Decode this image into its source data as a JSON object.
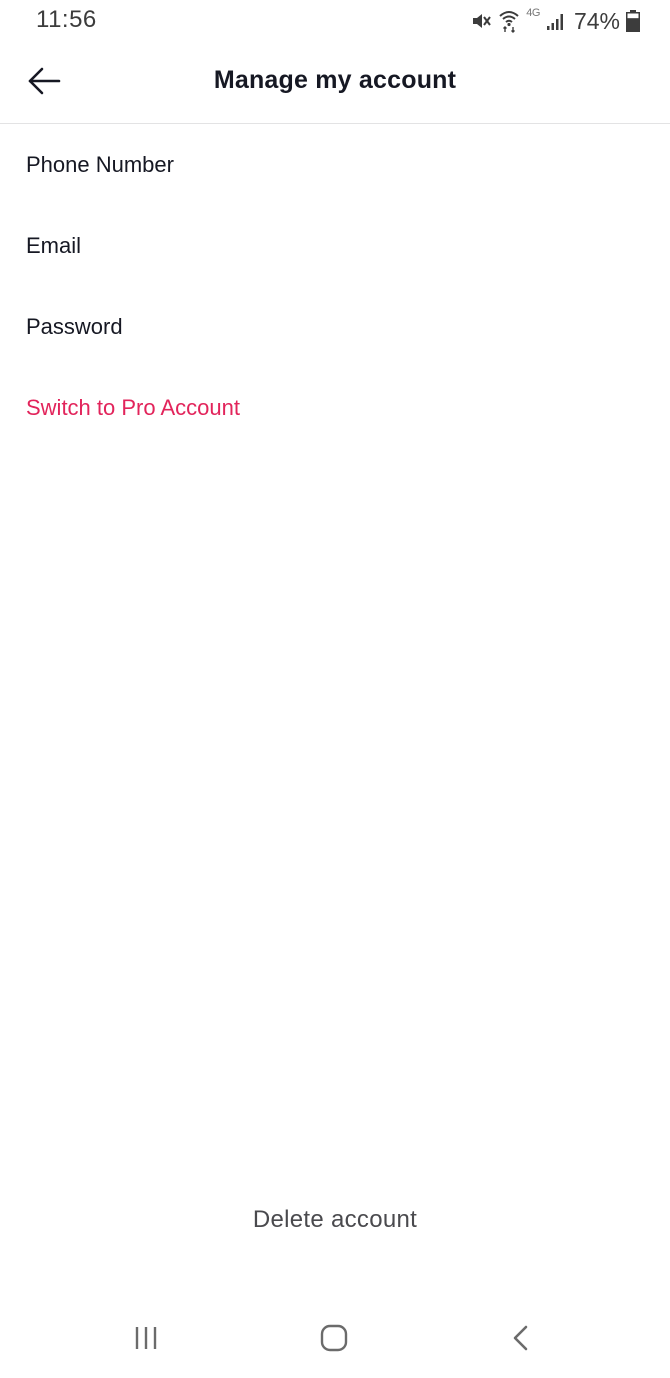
{
  "status_bar": {
    "time": "11:56",
    "network": "4G",
    "battery_percent": "74%",
    "battery_level": 0.74,
    "icons": [
      "mute-icon",
      "wifi-icon",
      "signal-icon",
      "battery-icon"
    ]
  },
  "header": {
    "title": "Manage my account",
    "back_icon": "arrow-left-icon"
  },
  "menu": {
    "items": [
      {
        "label": "Phone Number"
      },
      {
        "label": "Email"
      },
      {
        "label": "Password"
      },
      {
        "label": "Switch to Pro Account",
        "accent": "#e2245b"
      }
    ]
  },
  "footer": {
    "delete_label": "Delete account"
  },
  "system_nav": {
    "icons": [
      "recent-apps-icon",
      "home-icon",
      "back-icon"
    ]
  },
  "colors": {
    "accent": "#e2245b",
    "text": "#161823",
    "divider": "#e3e3e4"
  }
}
